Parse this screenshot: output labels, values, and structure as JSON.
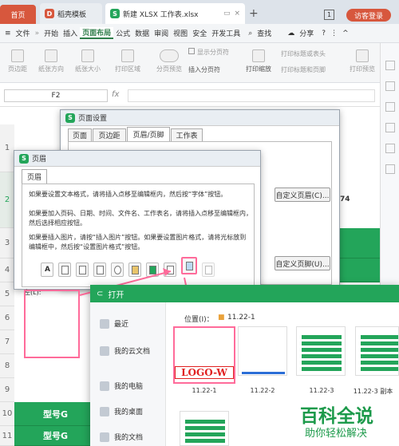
{
  "tabs": {
    "home": "首页",
    "template": "稻壳模板",
    "doc": "新建 XLSX 工作表.xlsx",
    "add": "+",
    "count": "1",
    "login": "访客登录"
  },
  "menu": {
    "hamburger": "≡",
    "file": "文件",
    "arrows": "»",
    "items": [
      "开始",
      "插入",
      "页面布局",
      "公式",
      "数据",
      "审阅",
      "视图",
      "安全",
      "开发工具"
    ],
    "active": "页面布局",
    "search": "查找",
    "share": "分享",
    "help": "?",
    "more": "⋮",
    "collapse": "^"
  },
  "toolbar": {
    "items": [
      "页边距",
      "纸张方向",
      "纸张大小",
      "打印区域",
      "分页预览",
      "显示分页符",
      "插入分页符",
      "打印缩放",
      "打印标题或表头",
      "打印标题和页脚",
      "打印预览"
    ]
  },
  "formula": {
    "cell": "F2",
    "fx": "fx",
    "zoom": "⊕"
  },
  "rows": [
    "1",
    "2",
    "3",
    "4",
    "5",
    "6",
    "7",
    "8",
    "9",
    "10",
    "11"
  ],
  "green_text": [
    "型号G",
    "型号G"
  ],
  "page_setup": {
    "title": "页面设置",
    "tabs": [
      "页面",
      "页边距",
      "页眉/页脚",
      "工作表"
    ],
    "active_tab": "页眉/页脚",
    "custom_header": "自定义页眉(C)...",
    "custom_footer": "自定义页脚(U)...",
    "right_fragment": "74"
  },
  "header_dlg": {
    "title": "页眉",
    "tab": "页眉",
    "text1": "如果要设置文本格式，请将插入点移至编辑框内，然后按“字体”按钮。",
    "text2": "如果要加入页码、日期、时间、文件名、工作表名，请将插入点移至编辑框内，然后选择相应按钮。",
    "text3": "如果要插入图片，请按“插入图片”按钮。如果要设置图片格式，请将光标放到编辑框中，然后按“设置图片格式”按钮。",
    "left_label": "左(L):"
  },
  "open_dlg": {
    "title": "打开",
    "location_label": "位置(I)：",
    "folder": "11.22-1",
    "nav": [
      "最近",
      "我的云文档",
      "我的电脑",
      "我的桌面",
      "我的文档"
    ],
    "files": [
      "11.22-1",
      "11.22-2",
      "11.22-3",
      "11.22-3 副本"
    ],
    "logo_text": "LOGO-W"
  },
  "watermark": {
    "brand": "百科全说",
    "sub": "助你轻松解决"
  },
  "colors": {
    "accent": "#23a55a",
    "brand_red": "#d7573d",
    "highlight": "#ff6b9a"
  }
}
